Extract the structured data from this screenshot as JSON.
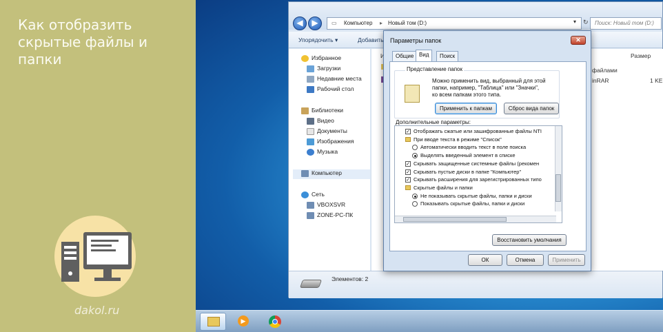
{
  "left_panel": {
    "title": "Как отобразить скрытые файлы и папки",
    "brand": "dakol.ru",
    "bg_color": "#c3c07c"
  },
  "explorer": {
    "address": {
      "part1": "Компьютер",
      "sep": "▸",
      "part2": "Новый том (D:)"
    },
    "search_placeholder": "Поиск: Новый том (D:)",
    "toolbar": {
      "organize": "Упорядочить ▾",
      "add": "Добавить"
    },
    "nav": {
      "favorites": "Избранное",
      "downloads": "Загрузки",
      "recent": "Недавние места",
      "desktop": "Рабочий стол",
      "libraries": "Библиотеки",
      "video": "Видео",
      "documents": "Документы",
      "images": "Изображения",
      "music": "Музыка",
      "computer": "Компьютер",
      "network": "Сеть",
      "host1": "VBOXSVR",
      "host2": "ZONE-PC-ПК"
    },
    "content": {
      "col_name": "И",
      "col_size": "Размер",
      "frag_files": "файлами",
      "frag_winrar": "inRAR",
      "frag_size": "1 KE"
    },
    "status": "Элементов: 2"
  },
  "dialog": {
    "title": "Параметры папок",
    "tabs": [
      "Общие",
      "Вид",
      "Поиск"
    ],
    "active_tab": "Вид",
    "group_title": "Представление папок",
    "group_text1": "Можно применить вид, выбранный для этой",
    "group_text2": "папки, например, \"Таблица\" или \"Значки\",",
    "group_text3": "ко всем папкам этого типа.",
    "apply_all": "Применить к папкам",
    "reset_view": "Сброс вида папок",
    "advanced_label": "Дополнительные параметры:",
    "options": [
      {
        "kind": "checkbox",
        "checked": true,
        "indent": 0,
        "text": "Отображать сжатые или зашифрованные файлы NTI"
      },
      {
        "kind": "folder",
        "indent": 0,
        "text": "При вводе текста в режиме \"Список\""
      },
      {
        "kind": "radio",
        "checked": false,
        "indent": 1,
        "text": "Автоматически вводить текст в поле поиска"
      },
      {
        "kind": "radio",
        "checked": true,
        "indent": 1,
        "text": "Выделять введенный элемент в списке"
      },
      {
        "kind": "checkbox",
        "checked": true,
        "indent": 0,
        "text": "Скрывать защищенные системные файлы (рекомен"
      },
      {
        "kind": "checkbox",
        "checked": true,
        "indent": 0,
        "text": "Скрывать пустые диски в папке \"Компьютер\""
      },
      {
        "kind": "checkbox",
        "checked": true,
        "indent": 0,
        "text": "Скрывать расширения для зарегистрированных типо"
      },
      {
        "kind": "folder",
        "indent": 0,
        "text": "Скрытые файлы и папки"
      },
      {
        "kind": "radio",
        "checked": true,
        "indent": 1,
        "text": "Не показывать скрытые файлы, папки и диски"
      },
      {
        "kind": "radio",
        "checked": false,
        "indent": 1,
        "text": "Показывать скрытые файлы, папки и диски"
      }
    ],
    "restore_defaults": "Восстановить умолчания",
    "ok": "ОК",
    "cancel": "Отмена",
    "apply": "Применить"
  },
  "taskbar": {
    "icons": [
      "explorer-icon",
      "media-player-icon",
      "chrome-icon"
    ]
  }
}
